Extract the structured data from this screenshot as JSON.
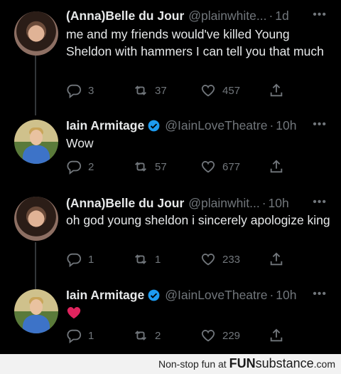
{
  "tweets": [
    {
      "author": "(Anna)Belle du Jour",
      "handle": "@plainwhite...",
      "time": "1d",
      "text": "me and my friends would've killed Young Sheldon with hammers I can tell you that much",
      "replies": "3",
      "retweets": "37",
      "likes": "457",
      "verified": false
    },
    {
      "author": "Iain Armitage",
      "handle": "@IainLoveTheatre",
      "time": "10h",
      "text": "Wow",
      "replies": "2",
      "retweets": "57",
      "likes": "677",
      "verified": true
    },
    {
      "author": "(Anna)Belle du Jour",
      "handle": "@plainwhit...",
      "time": "10h",
      "text": "oh god young sheldon i sincerely apologize king",
      "replies": "1",
      "retweets": "1",
      "likes": "233",
      "verified": false
    },
    {
      "author": "Iain Armitage",
      "handle": "@IainLoveTheatre",
      "time": "10h",
      "text": "",
      "emoji": "heart-emoji",
      "replies": "1",
      "retweets": "2",
      "likes": "229",
      "verified": true
    }
  ],
  "footer": {
    "prefix": "Non-stop fun at ",
    "brand_bold": "FUN",
    "brand_rest": "substance",
    "suffix": ".com"
  },
  "colors": {
    "background": "#000000",
    "text": "#e7e9ea",
    "muted": "#71767b",
    "verified": "#1d9bf0",
    "heart_emoji": "#e0245e"
  }
}
